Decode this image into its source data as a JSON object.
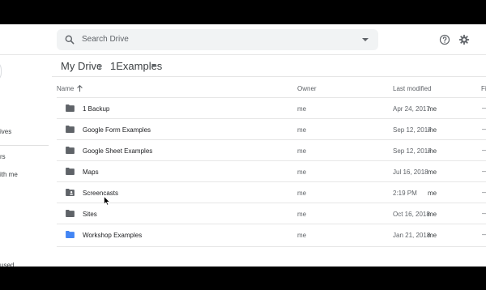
{
  "search": {
    "placeholder": "Search Drive"
  },
  "header": {
    "help_icon": "help-icon",
    "settings_icon": "gear-icon"
  },
  "sidebar": {
    "items": [
      {
        "label": "ives"
      },
      {
        "label": "rs"
      },
      {
        "label": "ith me"
      },
      {
        "label": "used"
      }
    ]
  },
  "breadcrumb": {
    "root": "My Drive",
    "current": "1Examples"
  },
  "table": {
    "columns": {
      "name": "Name",
      "owner": "Owner",
      "last_modified": "Last modified",
      "size": "Fi"
    },
    "rows": [
      {
        "name": "1 Backup",
        "owner": "me",
        "date": "Apr 24, 2017",
        "by": "me",
        "size": "—",
        "icon": "folder-icon",
        "color": "#5f6368"
      },
      {
        "name": "Google Form Examples",
        "owner": "me",
        "date": "Sep 12, 2017",
        "by": "me",
        "size": "—",
        "icon": "folder-icon",
        "color": "#5f6368"
      },
      {
        "name": "Google Sheet Examples",
        "owner": "me",
        "date": "Sep 12, 2017",
        "by": "me",
        "size": "—",
        "icon": "folder-icon",
        "color": "#5f6368"
      },
      {
        "name": "Maps",
        "owner": "me",
        "date": "Jul 16, 2018",
        "by": "me",
        "size": "—",
        "icon": "folder-icon",
        "color": "#5f6368"
      },
      {
        "name": "Screencasts",
        "owner": "me",
        "date": "2:19 PM",
        "by": "me",
        "size": "—",
        "icon": "shared-folder-icon",
        "color": "#5f6368"
      },
      {
        "name": "Sites",
        "owner": "me",
        "date": "Oct 16, 2018",
        "by": "me",
        "size": "—",
        "icon": "folder-icon",
        "color": "#5f6368"
      },
      {
        "name": "Workshop Examples",
        "owner": "me",
        "date": "Jan 21, 2018",
        "by": "me",
        "size": "—",
        "icon": "folder-icon",
        "color": "#4285f4"
      }
    ]
  }
}
